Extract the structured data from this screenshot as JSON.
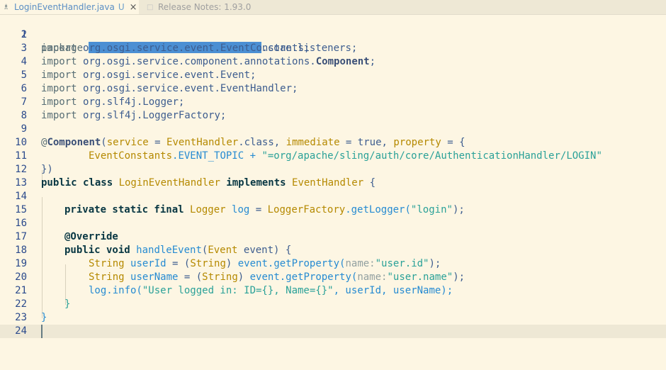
{
  "tabs": [
    {
      "label": "LoginEventHandler.java",
      "status": "U",
      "close": "×"
    },
    {
      "label": "Release Notes: 1.93.0"
    }
  ],
  "lines": {
    "l1": {
      "n": "1",
      "a": "package ",
      "b": ".core.listeners;"
    },
    "l2": {
      "n": "2"
    },
    "l3": {
      "n": "3",
      "a": "import ",
      "b": "org.osgi.service.event.EventConstants;"
    },
    "l4": {
      "n": "4",
      "a": "import ",
      "b": "org.osgi.service.component.annotations.",
      "c": "Component",
      ";": ";"
    },
    "l5": {
      "n": "5",
      "a": "import ",
      "b": "org.osgi.service.event.Event;"
    },
    "l6": {
      "n": "6",
      "a": "import ",
      "b": "org.osgi.service.event.EventHandler;"
    },
    "l7": {
      "n": "7",
      "a": "import ",
      "b": "org.slf4j.Logger;"
    },
    "l8": {
      "n": "8",
      "a": "import ",
      "b": "org.slf4j.LoggerFactory;"
    },
    "l9": {
      "n": "9"
    },
    "l10": {
      "n": "10",
      "a": "@",
      "b": "Component",
      "c": "(",
      "d": "service",
      "e": " = ",
      "f": "EventHandler",
      "g": ".class, ",
      "h": "immediate",
      "i": " = true, ",
      "j": "property",
      "k": " = {"
    },
    "l11": {
      "n": "11",
      "a": "EventConstants",
      "b": ".EVENT_TOPIC + ",
      "c": "\"=org/apache/sling/auth/core/AuthenticationHandler/LOGIN\""
    },
    "l12": {
      "n": "12",
      "a": "})"
    },
    "l13": {
      "n": "13",
      "a": "public class ",
      "b": "LoginEventHandler ",
      "c": "implements ",
      "d": "EventHandler ",
      "e": "{"
    },
    "l14": {
      "n": "14"
    },
    "l15": {
      "n": "15",
      "a": "private static final ",
      "b": "Logger ",
      "c": "log",
      "d": " = ",
      "e": "LoggerFactory",
      "f": ".getLogger(",
      "g": "\"login\"",
      "h": ");"
    },
    "l16": {
      "n": "16"
    },
    "l17": {
      "n": "17",
      "a": "@Override"
    },
    "l18": {
      "n": "18",
      "a": "public void ",
      "b": "handleEvent",
      "c": "(",
      "d": "Event ",
      "e": "event",
      ")": ") {"
    },
    "l19": {
      "n": "19",
      "a": "String ",
      "b": "userId",
      "c": " = (",
      "d": "String",
      "e": ") ",
      "f": "event.getProperty(",
      "g": "name:",
      "h": "\"user.id\"",
      "i": ");"
    },
    "l20": {
      "n": "20",
      "a": "String ",
      "b": "userName",
      "c": " = (",
      "d": "String",
      "e": ") ",
      "f": "event.getProperty(",
      "g": "name:",
      "h": "\"user.name\"",
      "i": ");"
    },
    "l21": {
      "n": "21",
      "a": "log.info(",
      "b": "\"User logged in: ID={}, Name={}\"",
      "c": ", userId, userName);"
    },
    "l22": {
      "n": "22",
      "a": "}"
    },
    "l23": {
      "n": "23",
      "a": "}"
    },
    "l24": {
      "n": "24"
    }
  },
  "colors": {
    "background": "#fdf6e3",
    "current_line": "#eee8d5",
    "redaction": "#4b8fd3"
  },
  "icons": {
    "file": "java-file-icon",
    "release": "document-icon"
  }
}
